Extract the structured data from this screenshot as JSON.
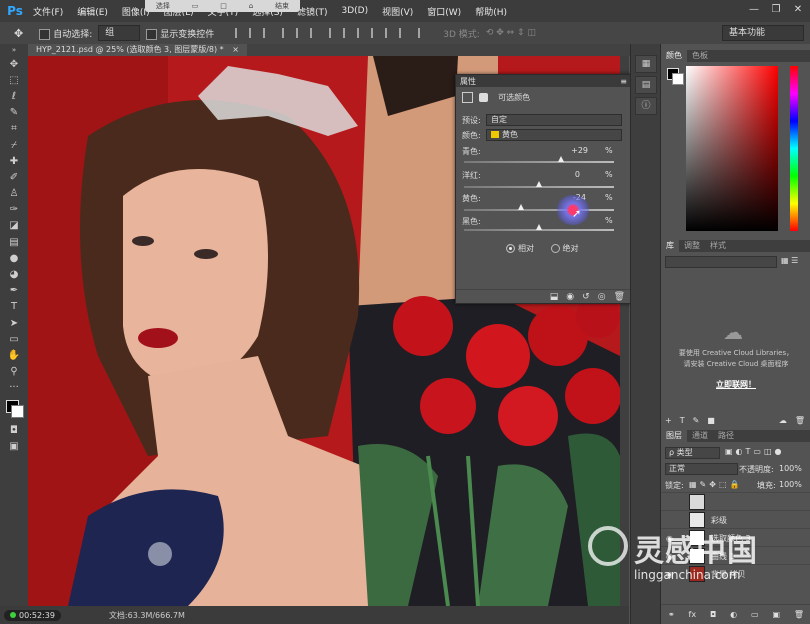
{
  "app": {
    "logo": "Ps"
  },
  "menubar": {
    "items": [
      "文件(F)",
      "编辑(E)",
      "图像(I)",
      "图层(L)",
      "文字(Y)",
      "选择(S)",
      "滤镜(T)",
      "3D(D)",
      "视图(V)",
      "窗口(W)",
      "帮助(H)"
    ],
    "floating_toolbar": [
      "选择",
      "结束"
    ],
    "window_controls": [
      "—",
      "❐",
      "✕"
    ]
  },
  "options": {
    "auto_select_label": "自动选择:",
    "auto_select_value": "组",
    "show_transform_label": "显示变换控件",
    "mode_3d_label": "3D 模式:",
    "workspace": "基本功能"
  },
  "document": {
    "tab_title": "HYP_2121.psd @ 25% (选取颜色 3, 图层蒙版/8) *",
    "status_time": "00:52:39",
    "status_doc": "文档:63.3M/666.7M"
  },
  "properties": {
    "tab": "属性",
    "title": "可选颜色",
    "preset_label": "预设:",
    "preset_value": "自定",
    "color_label": "颜色:",
    "color_value": "黄色",
    "color_swatch": "#f0c800",
    "sliders": [
      {
        "label": "青色:",
        "value": "+29",
        "unit": "%",
        "pos": 0.645
      },
      {
        "label": "洋红:",
        "value": "0",
        "unit": "%",
        "pos": 0.5
      },
      {
        "label": "黄色:",
        "value": "-24",
        "unit": "%",
        "pos": 0.38
      },
      {
        "label": "黑色:",
        "value": "",
        "unit": "%",
        "pos": 0.5
      }
    ],
    "method_relative": "相对",
    "method_absolute": "绝对"
  },
  "panels": {
    "color_tabs": [
      "颜色",
      "色板"
    ],
    "library_tabs": [
      "库",
      "调整",
      "样式"
    ],
    "library_text_1": "要使用 Creative Cloud Libraries，",
    "library_text_2": "请安装 Creative Cloud 桌面程序",
    "library_link": "立即联网！",
    "layers_tabs": [
      "图层",
      "通道",
      "路径"
    ],
    "layer_filter": "ρ 类型",
    "blend_mode": "正常",
    "opacity_label": "不透明度:",
    "opacity_value": "100%",
    "lock_label": "锁定:",
    "fill_label": "填充:",
    "fill_value": "100%",
    "layers": [
      {
        "name": "",
        "thumb": "#d9d9d9"
      },
      {
        "name": "彩级",
        "thumb": "#e8e8e8"
      },
      {
        "name": "选取颜色 3",
        "thumb": "#ffffff"
      },
      {
        "name": "曲线 1",
        "thumb": "#ffffff"
      },
      {
        "name": "背景 拷贝",
        "thumb": "#9a2a20"
      }
    ]
  },
  "watermark": {
    "cn": "灵感中国",
    "url": "lingganchina.com"
  },
  "colors": {
    "red_bg": "#b5191b",
    "ui_dark": "#3c3c3c",
    "ui_panel": "#535353",
    "foreground": "#000000",
    "background": "#ffffff"
  }
}
